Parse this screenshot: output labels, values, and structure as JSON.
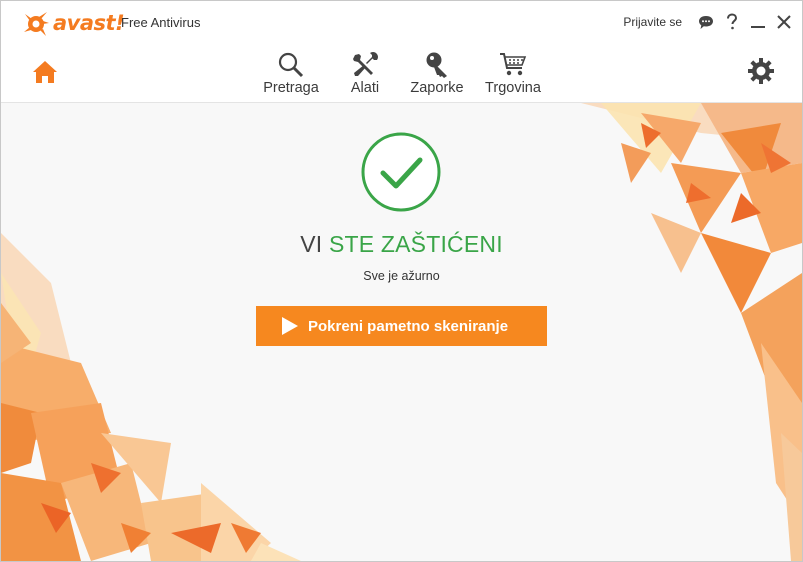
{
  "app": {
    "logo_text": "avast!",
    "product_name": "Free Antivirus",
    "accent_color": "#f47b20",
    "status_color": "#3aa548"
  },
  "titlebar": {
    "sign_in": "Prijavite se",
    "icons": [
      "chat-icon",
      "help-icon",
      "minimize-icon",
      "close-icon"
    ]
  },
  "nav": {
    "items": [
      {
        "label": "Pretraga",
        "icon": "search-icon"
      },
      {
        "label": "Alati",
        "icon": "tools-icon"
      },
      {
        "label": "Zaporke",
        "icon": "key-icon"
      },
      {
        "label": "Trgovina",
        "icon": "cart-icon"
      }
    ],
    "left_icon": "home-icon",
    "right_icon": "gear-icon"
  },
  "main": {
    "status_prefix": "VI ",
    "status_highlight": "STE ZAŠTIĆENI",
    "substatus": "Sve je ažurno",
    "scan_button": "Pokreni pametno skeniranje"
  }
}
